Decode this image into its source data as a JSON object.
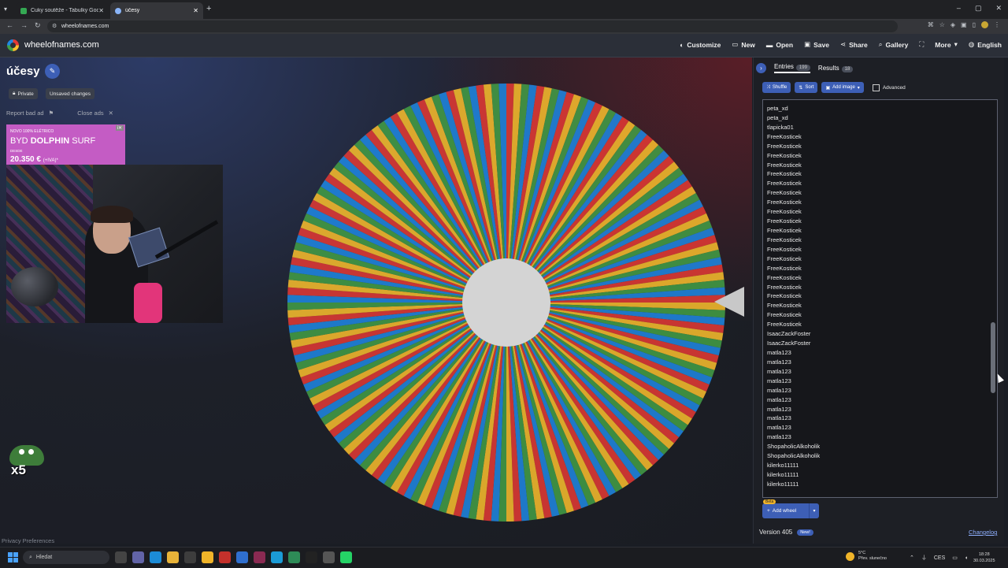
{
  "browser": {
    "tabs": [
      {
        "label": "Cuky soutěže - Tabulky Google",
        "favicon_color": "#34a853"
      },
      {
        "label": "účesy",
        "favicon_color": "#8ab4f8"
      }
    ],
    "url": "wheelofnames.com"
  },
  "site": {
    "name": "wheelofnames.com",
    "menu": [
      {
        "icon": "palette-icon",
        "glyph": "◐",
        "label": "Customize"
      },
      {
        "icon": "new-file-icon",
        "glyph": "▭",
        "label": "New"
      },
      {
        "icon": "folder-icon",
        "glyph": "▬",
        "label": "Open"
      },
      {
        "icon": "save-icon",
        "glyph": "▣",
        "label": "Save"
      },
      {
        "icon": "share-icon",
        "glyph": "⋖",
        "label": "Share"
      },
      {
        "icon": "search-icon",
        "glyph": "⌕",
        "label": "Gallery"
      },
      {
        "icon": "fullscreen-icon",
        "glyph": "⛶",
        "label": ""
      },
      {
        "icon": "chevron-down-icon",
        "glyph": "▾",
        "label": "More"
      },
      {
        "icon": "globe-icon",
        "glyph": "◍",
        "label": "English"
      }
    ]
  },
  "wheel": {
    "title": "účesy",
    "badges": {
      "private": "Private",
      "unsaved": "Unsaved changes"
    },
    "ad_links": {
      "report": "Report bad ad",
      "close": "Close ads"
    },
    "segment_colors": [
      "#e53935",
      "#fbc02d",
      "#43a047",
      "#1e88e5"
    ],
    "segment_count": 180,
    "center_color": "#d4d4d4",
    "pointer_color": "#c8c8c8"
  },
  "ad": {
    "small": "NOVO 100% ELÉTRICO",
    "title_prefix": "BYD ",
    "title_bold": "DOLPHIN",
    "title_suffix": " SURF",
    "sub": "DESDE",
    "price": "20.350 €",
    "price_note": "(+IVA)*"
  },
  "stream": {
    "emote_text": "x5"
  },
  "privacy": "Privacy Preferences",
  "panel": {
    "tabs": [
      {
        "label": "Entries",
        "count": "199"
      },
      {
        "label": "Results",
        "count": "18"
      }
    ],
    "toolbar": {
      "shuffle": "Shuffle",
      "sort": "Sort",
      "add_image": "Add image",
      "advanced": "Advanced"
    },
    "entries": [
      "peta_xd",
      "peta_xd",
      "tlapicka01",
      "FreeKosticek",
      "FreeKosticek",
      "FreeKosticek",
      "FreeKosticek",
      "FreeKosticek",
      "FreeKosticek",
      "FreeKosticek",
      "FreeKosticek",
      "FreeKosticek",
      "FreeKosticek",
      "FreeKosticek",
      "FreeKosticek",
      "FreeKosticek",
      "FreeKosticek",
      "FreeKosticek",
      "FreeKosticek",
      "FreeKosticek",
      "FreeKosticek",
      "FreeKosticek",
      "FreeKosticek",
      "FreeKosticek",
      "IsaacZackFoster",
      "IsaacZackFoster",
      "matla123",
      "matla123",
      "matla123",
      "matla123",
      "matla123",
      "matla123",
      "matla123",
      "matla123",
      "matla123",
      "matla123",
      "ShopaholicAlkoholik",
      "ShopaholicAlkoholik",
      "kilerko11111",
      "kilerko11111",
      "kilerko11111"
    ],
    "add_wheel": {
      "beta": "Beta",
      "label": "Add wheel"
    },
    "version": "Version 405",
    "new_badge": "New!",
    "changelog": "Changelog"
  },
  "taskbar": {
    "search": "Hledat",
    "weather": {
      "temp": "5°C",
      "desc": "Přev. slunečno"
    },
    "lang": "CES",
    "time": "18:28",
    "date": "30.03.2025"
  }
}
